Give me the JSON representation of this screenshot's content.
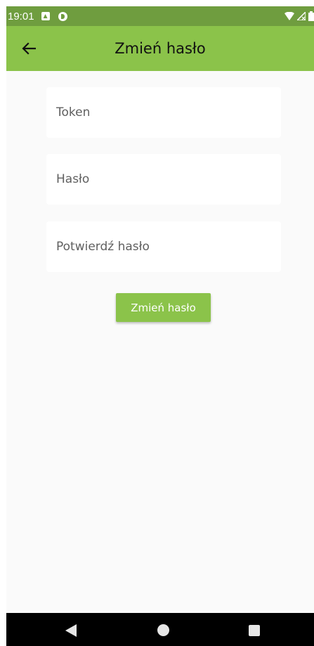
{
  "status_bar": {
    "time": "19:01",
    "icons": [
      "notification-a-icon",
      "notification-circle-icon",
      "wifi-icon",
      "signal-icon",
      "battery-icon"
    ]
  },
  "app_bar": {
    "title": "Zmień hasło",
    "back_icon": "arrow-back-icon",
    "color": "#8bc34a"
  },
  "form": {
    "token_placeholder": "Token",
    "password_placeholder": "Hasło",
    "confirm_password_placeholder": "Potwierdź hasło",
    "submit_label": "Zmień hasło"
  },
  "nav_bar": {
    "icons": [
      "nav-back-icon",
      "nav-home-icon",
      "nav-recents-icon"
    ]
  },
  "colors": {
    "accent": "#8bc34a",
    "status_bar": "#6f9d3f",
    "background": "#fafafa"
  }
}
